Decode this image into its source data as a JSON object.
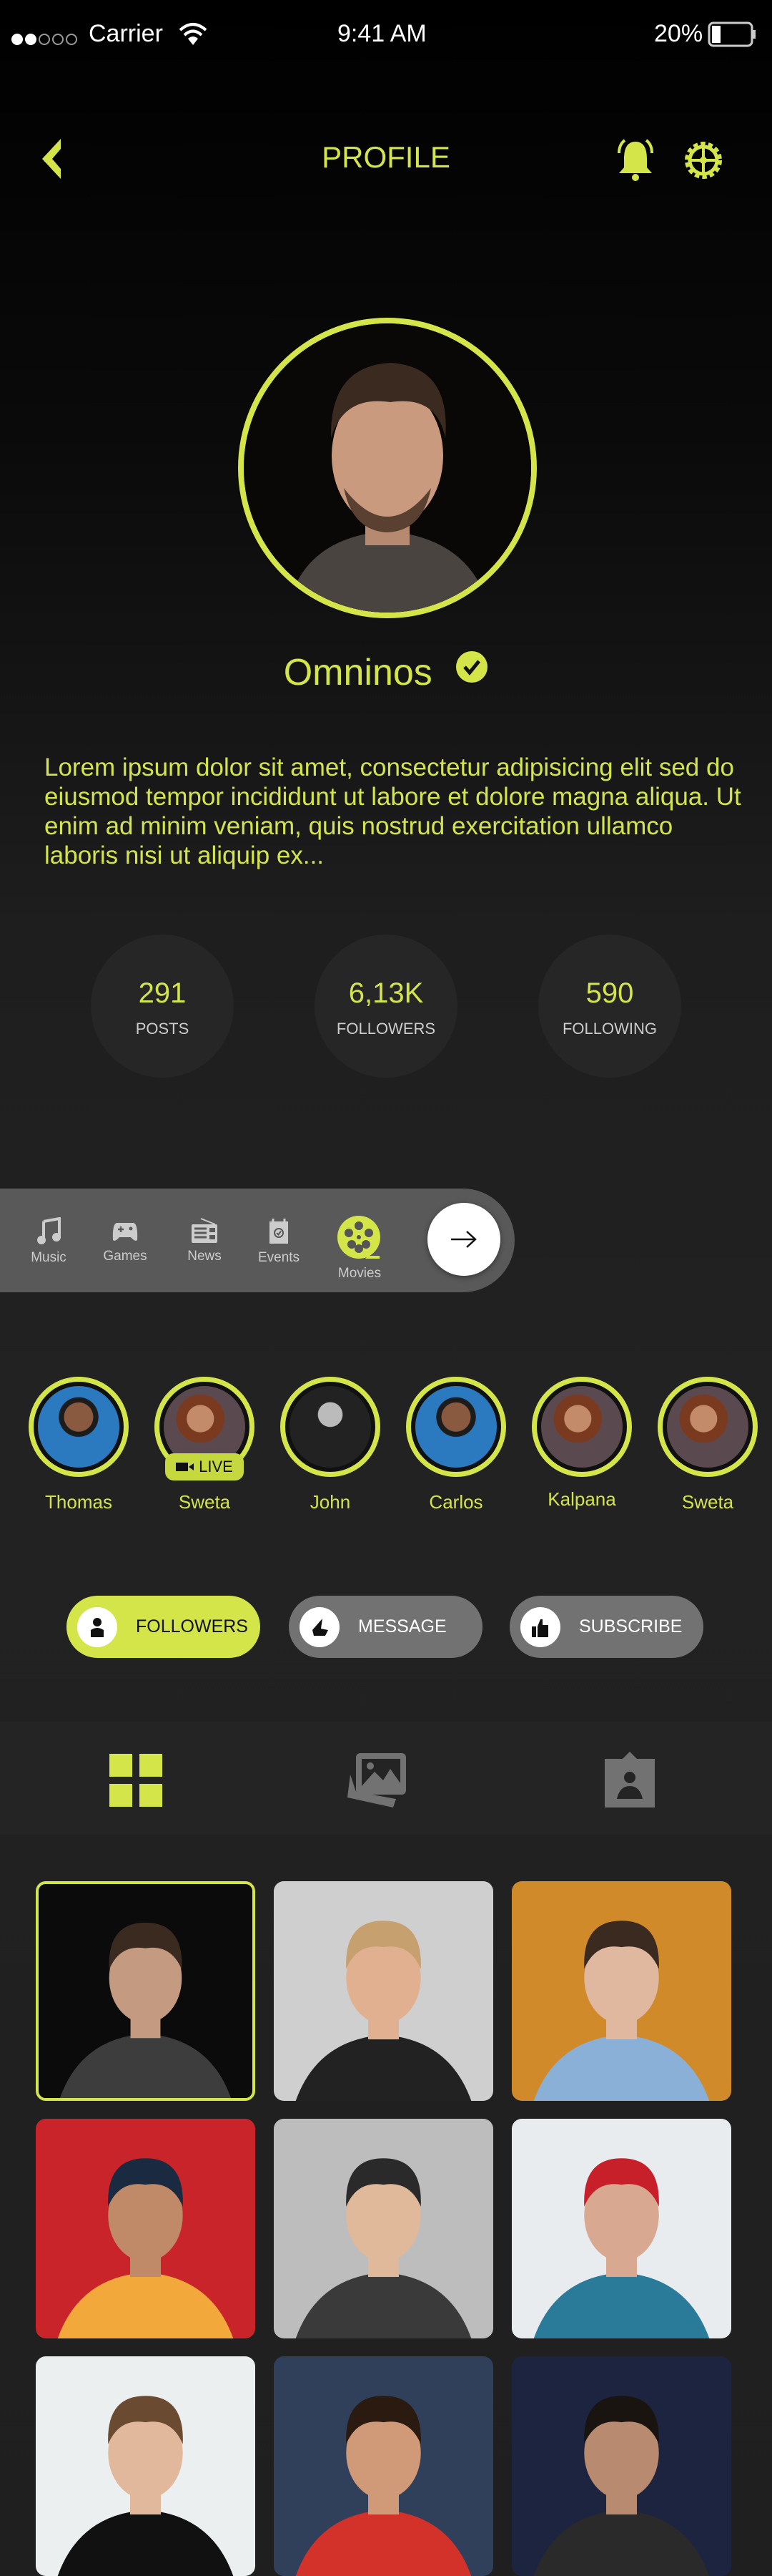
{
  "status_bar": {
    "carrier": "Carrier",
    "time": "9:41 AM",
    "battery": "20%",
    "battery_level": 0.2
  },
  "header": {
    "title": "PROFILE"
  },
  "profile": {
    "name": "Omninos",
    "verified": true,
    "bio": "Lorem ipsum dolor sit amet, consectetur adipisicing elit sed do eiusmod tempor incididunt ut labore et dolore magna aliqua. Ut enim ad minim veniam, quis nostrud exercitation ullamco laboris nisi ut aliquip ex..."
  },
  "stats": [
    {
      "value": "291",
      "label": "POSTS"
    },
    {
      "value": "6,13K",
      "label": "FOLLOWERS"
    },
    {
      "value": "590",
      "label": "FOLLOWING"
    }
  ],
  "categories": [
    {
      "label": "Music",
      "icon": "music-icon"
    },
    {
      "label": "Games",
      "icon": "gamepad-icon"
    },
    {
      "label": "News",
      "icon": "radio-icon"
    },
    {
      "label": "Events",
      "icon": "calendar-icon"
    },
    {
      "label": "Movies",
      "icon": "film-reel-icon",
      "active": true
    }
  ],
  "stories": [
    {
      "name": "Thomas"
    },
    {
      "name": "Sweta",
      "live": "LIVE"
    },
    {
      "name": "John"
    },
    {
      "name": "Carlos"
    },
    {
      "name": "Kalpana"
    },
    {
      "name": "Sweta"
    }
  ],
  "actions": {
    "followers": "FOLLOWERS",
    "message": "MESSAGE",
    "subscribe": "SUBSCRIBE"
  },
  "tabs": [
    {
      "icon": "grid-icon",
      "active": true
    },
    {
      "icon": "gallery-icon"
    },
    {
      "icon": "portrait-icon"
    }
  ],
  "colors": {
    "accent": "#d4e54a",
    "background": "#1e1e1e",
    "inactive": "#727272"
  }
}
